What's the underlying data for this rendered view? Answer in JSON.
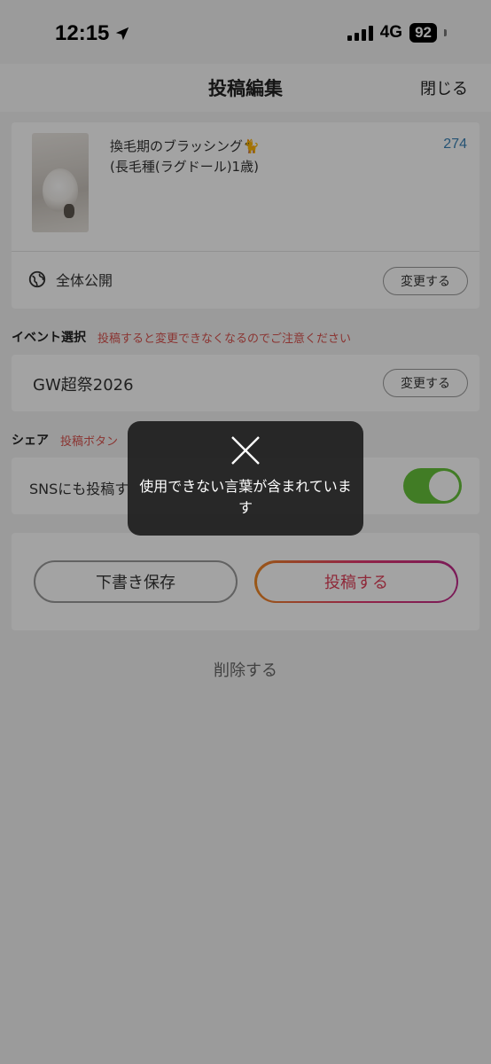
{
  "status_bar": {
    "time": "12:15",
    "network": "4G",
    "battery": "92"
  },
  "header": {
    "title": "投稿編集",
    "close_label": "閉じる"
  },
  "post": {
    "title_line1": "換毛期のブラッシング🐈",
    "title_line2": "(長毛種(ラグドール)1歳)",
    "count": "274",
    "visibility_label": "全体公開",
    "visibility_change_label": "変更する"
  },
  "event_section": {
    "heading": "イベント選択",
    "note": "投稿すると変更できなくなるのでご注意ください",
    "event_name": "GW超祭2026",
    "change_label": "変更する"
  },
  "share_section": {
    "heading": "シェア",
    "note": "投稿ボタン",
    "sns_label": "SNSにも投稿す",
    "sns_enabled": true,
    "toggle_color": "#67c23a"
  },
  "actions": {
    "draft_label": "下書き保存",
    "submit_label": "投稿する",
    "delete_label": "削除する"
  },
  "toast": {
    "icon": "close-x-icon",
    "message": "使用できない言葉が含まれています"
  }
}
